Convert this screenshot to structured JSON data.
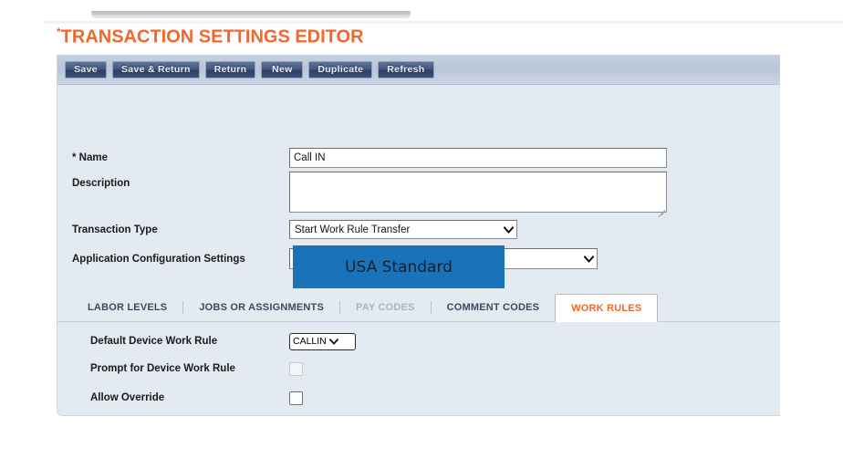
{
  "page": {
    "title": "TRANSACTION SETTINGS EDITOR",
    "title_required_marker": "*",
    "accent_color": "#f2672b",
    "panel_background": "#e4eaf2"
  },
  "toolbar": {
    "buttons": [
      {
        "label": "Save",
        "name": "save-button"
      },
      {
        "label": "Save & Return",
        "name": "save-and-return-button"
      },
      {
        "label": "Return",
        "name": "return-button"
      },
      {
        "label": "New",
        "name": "new-button"
      },
      {
        "label": "Duplicate",
        "name": "duplicate-button"
      },
      {
        "label": "Refresh",
        "name": "refresh-button"
      }
    ]
  },
  "form": {
    "name": {
      "label": "* Name",
      "value": "Call IN",
      "placeholder": ""
    },
    "description": {
      "label": "Description",
      "value": "",
      "placeholder": ""
    },
    "transaction_type": {
      "label": "Transaction Type",
      "selected": "Start Work Rule Transfer"
    },
    "application_configuration_settings": {
      "label": "Application Configuration Settings",
      "selected": ""
    },
    "overlay": {
      "text": "USA Standard",
      "background_color": "#1a72b8"
    }
  },
  "tabs": [
    {
      "label": "LABOR LEVELS",
      "name": "tab-labor-levels",
      "state": "enabled"
    },
    {
      "label": "JOBS OR ASSIGNMENTS",
      "name": "tab-jobs-or-assignments",
      "state": "enabled"
    },
    {
      "label": "PAY CODES",
      "name": "tab-pay-codes",
      "state": "disabled"
    },
    {
      "label": "COMMENT CODES",
      "name": "tab-comment-codes",
      "state": "enabled"
    },
    {
      "label": "WORK RULES",
      "name": "tab-work-rules",
      "state": "active"
    }
  ],
  "work_rules": {
    "default_device_work_rule": {
      "label": "Default Device Work Rule",
      "selected": "CALLIN"
    },
    "prompt_for_device_work_rule": {
      "label": "Prompt for Device Work Rule",
      "checked": false,
      "enabled": false
    },
    "allow_override": {
      "label": "Allow Override",
      "checked": false,
      "enabled": true
    }
  }
}
